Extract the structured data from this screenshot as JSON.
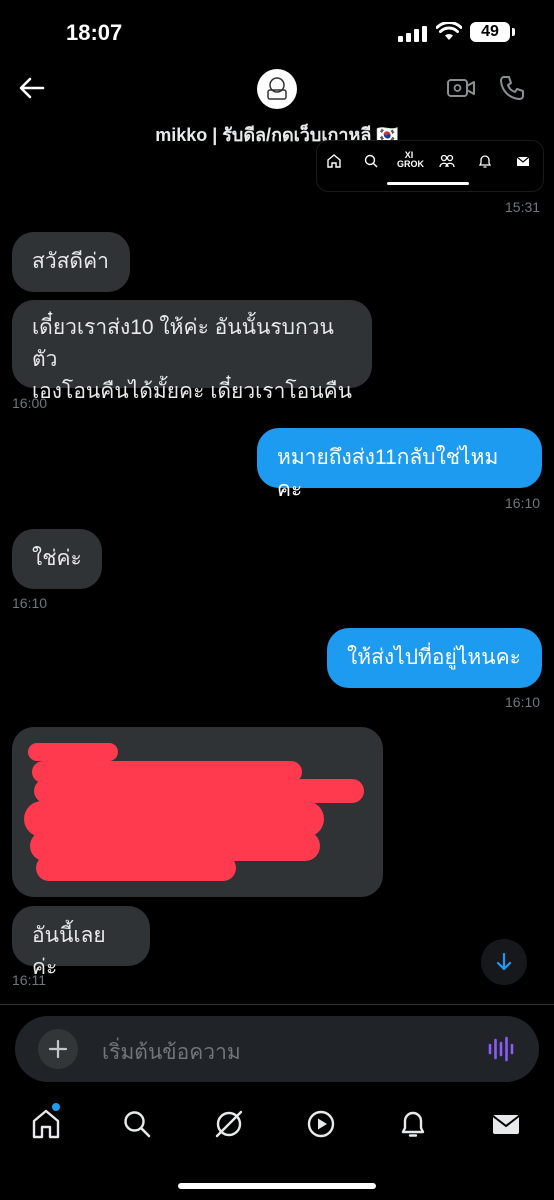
{
  "status_bar": {
    "time": "18:07",
    "battery": "49"
  },
  "header": {
    "title": "mikko | รับดีล/กดเว็บเกาหลี 🇰🇷",
    "mini_nav_label": "XI GROK"
  },
  "messages": [
    {
      "id": "ts-top",
      "kind": "timestamp",
      "text": "15:31"
    },
    {
      "id": "m1",
      "direction": "incoming",
      "text": "สวัสดีค่า"
    },
    {
      "id": "m2",
      "direction": "incoming",
      "lines": [
        "เดี๋ยวเราส่ง10 ให้ค่ะ อันนั้นรบกวนตัว",
        "เองโอนคืนได้มั้ยคะ เดี๋ยวเราโอนคืน"
      ],
      "time": "16:00"
    },
    {
      "id": "m3",
      "direction": "outgoing",
      "text": "หมายถึงส่ง11กลับใช่ไหมคะ",
      "time": "16:10"
    },
    {
      "id": "m4",
      "direction": "incoming",
      "text": "ใช่ค่ะ",
      "time": "16:10"
    },
    {
      "id": "m5",
      "direction": "outgoing",
      "text": "ให้ส่งไปที่อยู่ไหนคะ",
      "time": "16:10"
    },
    {
      "id": "m6",
      "direction": "incoming",
      "redacted": true
    },
    {
      "id": "m7",
      "direction": "incoming",
      "text": "อันนี้เลยค่ะ",
      "time": "16:11"
    }
  ],
  "composer": {
    "placeholder": "เริ่มต้นข้อความ"
  },
  "bottom_nav": [
    "home-icon",
    "search-icon",
    "grok-icon",
    "video-icon",
    "notifications-icon",
    "messages-icon"
  ],
  "colors": {
    "outgoing": "#1d9bf0",
    "incoming": "#2f3336",
    "redaction": "#ff3a4f"
  }
}
